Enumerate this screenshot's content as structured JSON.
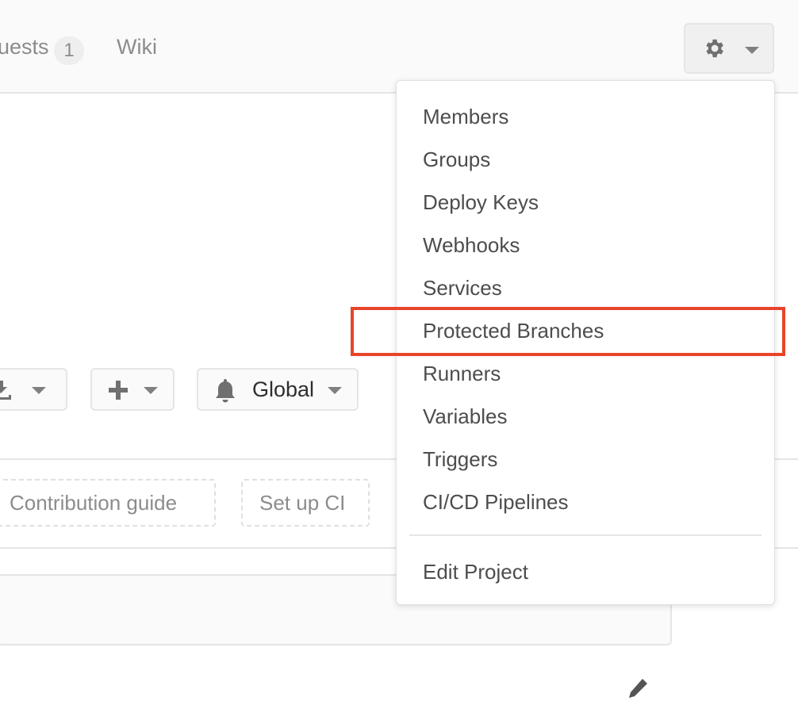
{
  "topnav": {
    "items": [
      {
        "label": "uests",
        "badge": "1"
      },
      {
        "label": "Wiki"
      }
    ]
  },
  "settings_button": {
    "icon": "gear-icon",
    "caret": "chevron-down-icon"
  },
  "toolbar": {
    "download_icon": "download-icon",
    "add_icon": "plus-icon",
    "notification": {
      "icon": "bell-icon",
      "label": "Global"
    }
  },
  "quick_links": [
    {
      "label": "Contribution guide"
    },
    {
      "label": "Set up CI"
    }
  ],
  "settings_menu": {
    "items": [
      {
        "label": "Members"
      },
      {
        "label": "Groups"
      },
      {
        "label": "Deploy Keys"
      },
      {
        "label": "Webhooks"
      },
      {
        "label": "Services"
      },
      {
        "label": "Protected Branches",
        "highlighted": true
      },
      {
        "label": "Runners"
      },
      {
        "label": "Variables"
      },
      {
        "label": "Triggers"
      },
      {
        "label": "CI/CD Pipelines"
      }
    ],
    "footer_item": {
      "label": "Edit Project"
    }
  },
  "colors": {
    "highlight_border": "#e8442a",
    "menu_text": "#4d4d4d",
    "muted_text": "#8c8c8c"
  }
}
